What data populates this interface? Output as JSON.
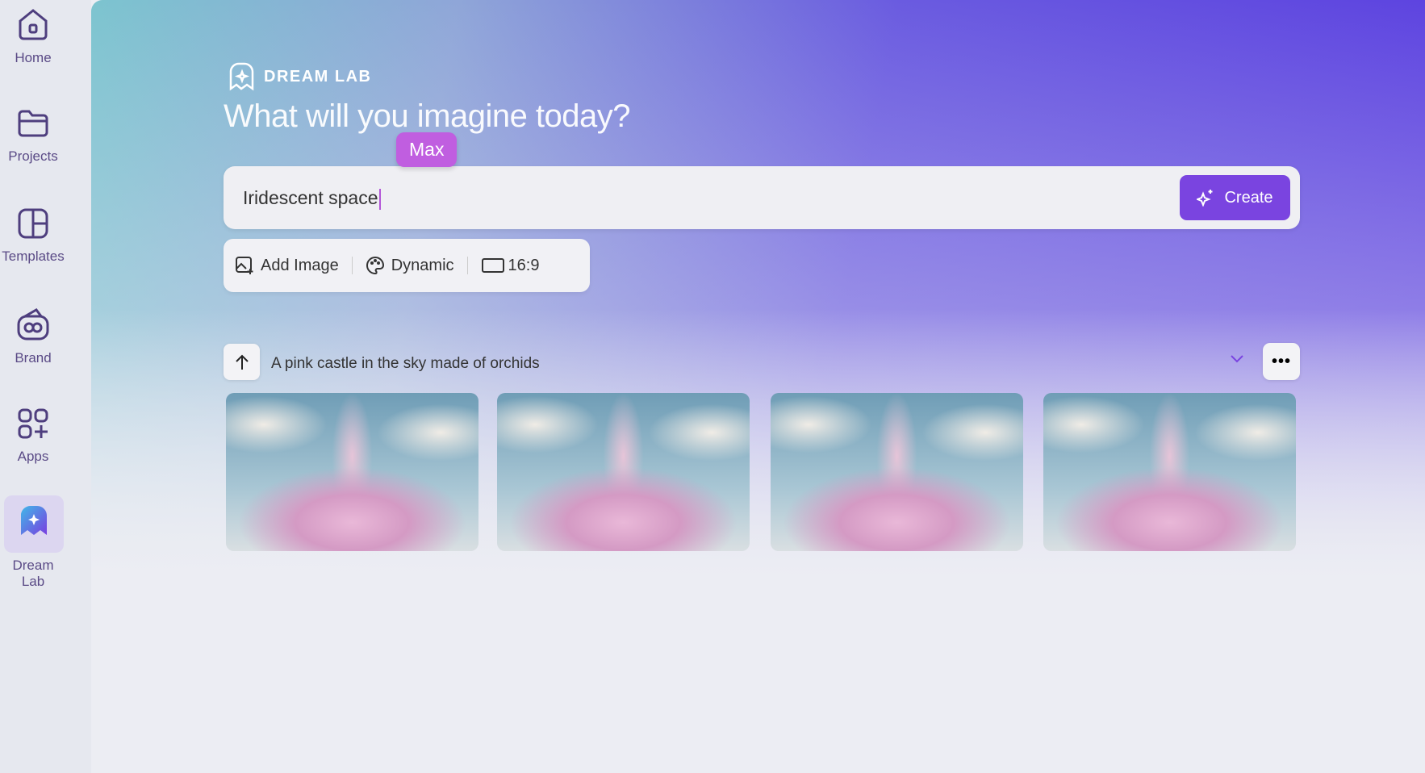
{
  "sidebar": {
    "items": [
      {
        "label": "Home",
        "icon": "home-icon"
      },
      {
        "label": "Projects",
        "icon": "folder-icon"
      },
      {
        "label": "Templates",
        "icon": "templates-icon"
      },
      {
        "label": "Brand",
        "icon": "brand-icon"
      },
      {
        "label": "Apps",
        "icon": "apps-icon"
      },
      {
        "label": "Dream Lab",
        "icon": "dream-lab-icon",
        "active": true
      }
    ]
  },
  "header": {
    "brand": "DREAM LAB",
    "title": "What will you imagine today?"
  },
  "prompt": {
    "value": "Iridescent space",
    "collaborator_cursor": "Max",
    "create_label": "Create"
  },
  "toolbar": {
    "add_image": "Add Image",
    "style": "Dynamic",
    "aspect_ratio": "16:9"
  },
  "history": {
    "prompt": "A pink castle in the sky made of orchids",
    "more_label": "•••",
    "images": [
      "pink castle image 1",
      "pink castle image 2",
      "pink castle image 3",
      "pink castle image 4"
    ]
  },
  "colors": {
    "accent": "#7a44e0",
    "cursor": "#c05ee0"
  }
}
